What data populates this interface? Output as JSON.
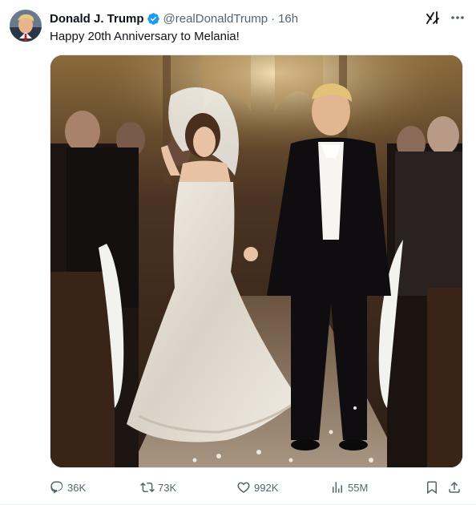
{
  "author": {
    "display_name": "Donald J. Trump",
    "handle": "@realDonaldTrump",
    "separator": "·",
    "time": "16h",
    "verified_icon": "verified-badge-icon",
    "avatar_icon": "profile-avatar"
  },
  "tweet": {
    "text": "Happy 20th Anniversary to Melania!",
    "media_description_icon": "wedding-photo"
  },
  "header_icons": {
    "grok": "grok-icon",
    "more": "more-options-icon"
  },
  "actions": {
    "replies": "36K",
    "reposts": "73K",
    "likes": "992K",
    "views": "55M",
    "bookmark_icon": "bookmark-icon",
    "share_icon": "share-icon"
  },
  "colors": {
    "verified_blue": "#1d9bf0",
    "muted_text": "#536471",
    "main_text": "#0f1419"
  }
}
